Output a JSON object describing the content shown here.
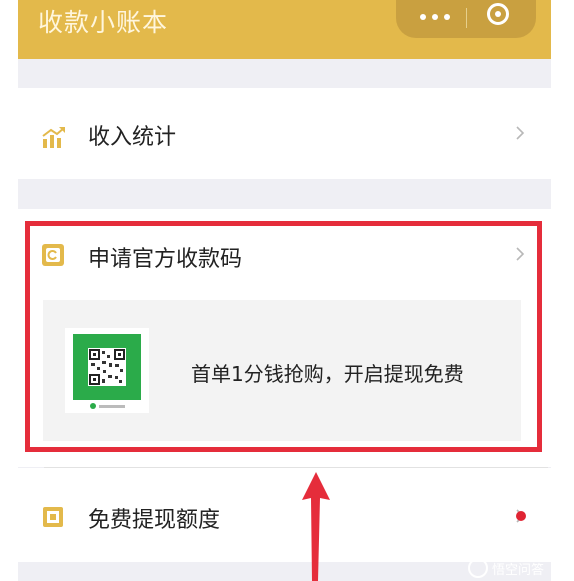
{
  "header": {
    "title": "收款小账本",
    "more_icon": "ellipsis-icon",
    "close_icon": "target-icon"
  },
  "menu": [
    {
      "label": "收入统计",
      "icon": "bar-chart-icon"
    },
    {
      "label": "申请官方收款码",
      "icon": "qr-code-icon"
    },
    {
      "label": "免费提现额度",
      "icon": "wallet-icon",
      "has_badge": true
    }
  ],
  "promo": {
    "text": "首单1分钱抢购，开启提现免费",
    "card_header": "",
    "card_footer": ""
  },
  "highlight": {
    "box_color": "#e52d3b",
    "arrow_color": "#e52d3b"
  },
  "watermark": {
    "text": "悟空问答",
    "logo": "wukong-logo"
  },
  "colors": {
    "brand": "#e3b94b",
    "badge": "#e02433",
    "qr_green": "#2bab4a"
  }
}
